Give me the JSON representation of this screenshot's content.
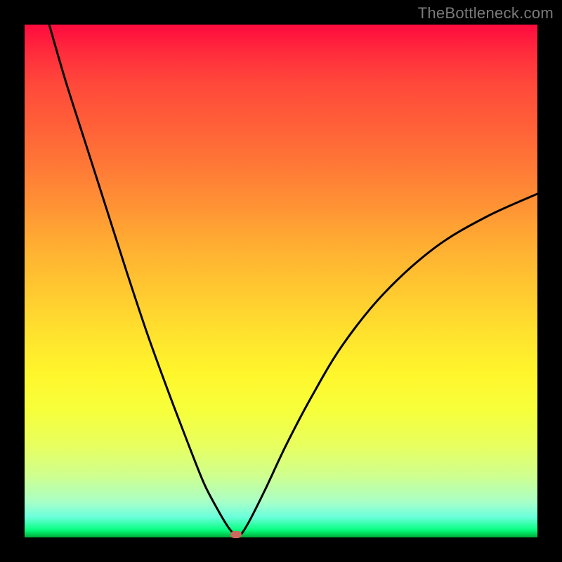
{
  "watermark": "TheBottleneck.com",
  "chart_data": {
    "type": "line",
    "title": "",
    "xlabel": "",
    "ylabel": "",
    "xlim": [
      0,
      100
    ],
    "ylim": [
      0,
      100
    ],
    "grid": false,
    "series": [
      {
        "name": "bottleneck-curve",
        "x": [
          4.8,
          8,
          12,
          16,
          20,
          24,
          28,
          32,
          35,
          37.5,
          39,
          40,
          40.8,
          41.5,
          42.3,
          44,
          47,
          51,
          56,
          62,
          70,
          80,
          90,
          100
        ],
        "y": [
          100,
          89,
          76.5,
          64,
          51.5,
          39.5,
          28.5,
          18,
          10.5,
          5.7,
          3.1,
          1.6,
          0.7,
          0.2,
          0.7,
          3.5,
          9.5,
          18,
          27.5,
          37.5,
          47.5,
          56.5,
          62.5,
          67
        ]
      }
    ],
    "marker": {
      "x": 41.2,
      "y": 0.5,
      "color": "#cb6a5e"
    },
    "gradient_stops": [
      {
        "pos": 0,
        "color": "#ff0b3e"
      },
      {
        "pos": 0.5,
        "color": "#ffe12e"
      },
      {
        "pos": 0.98,
        "color": "#0eff87"
      },
      {
        "pos": 1.0,
        "color": "#00a83a"
      }
    ]
  }
}
